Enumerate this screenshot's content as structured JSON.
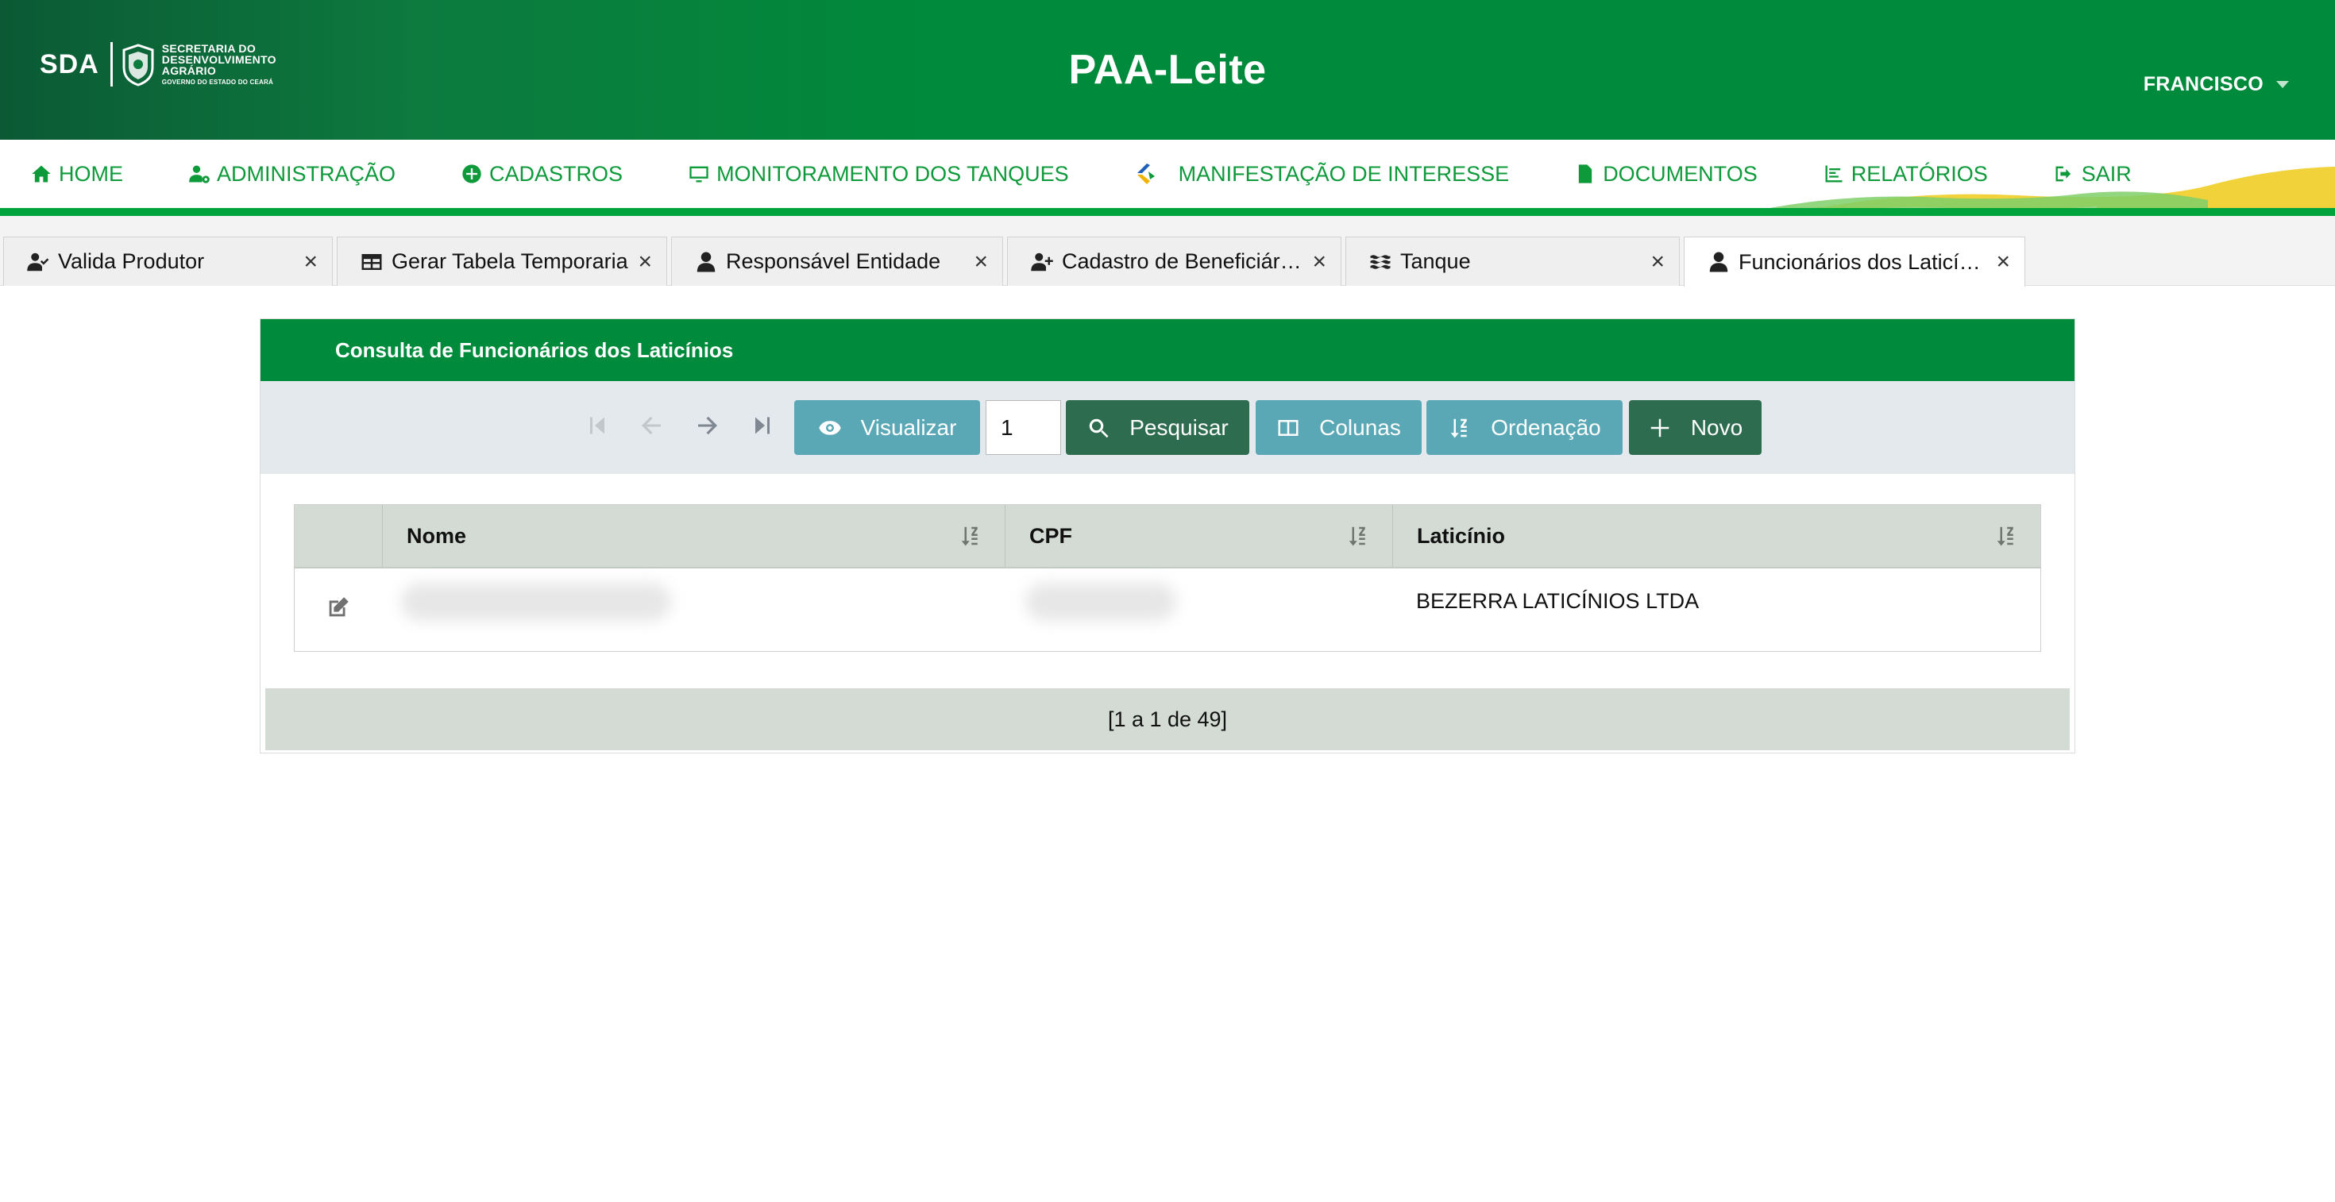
{
  "header": {
    "logo_abbr": "SDA",
    "logo_line1": "SECRETARIA DO",
    "logo_line2": "DESENVOLVIMENTO",
    "logo_line3": "AGRÁRIO",
    "logo_line4": "GOVERNO DO ESTADO DO CEARÁ",
    "title": "PAA-Leite",
    "user": "FRANCISCO"
  },
  "nav": {
    "items": [
      {
        "label": "HOME",
        "icon": "home-icon"
      },
      {
        "label": "ADMINISTRAÇÃO",
        "icon": "user-gear-icon"
      },
      {
        "label": "CADASTROS",
        "icon": "plus-circle-icon"
      },
      {
        "label": "MONITORAMENTO DOS TANQUES",
        "icon": "monitor-icon"
      },
      {
        "label": "MANIFESTAÇÃO DE INTERESSE",
        "icon": "manifestation-logo-icon"
      },
      {
        "label": "DOCUMENTOS",
        "icon": "document-icon"
      },
      {
        "label": "RELATÓRIOS",
        "icon": "chart-icon"
      },
      {
        "label": "SAIR",
        "icon": "sign-out-icon"
      }
    ]
  },
  "tabs": [
    {
      "label": "Valida Produtor",
      "icon": "user-check-icon"
    },
    {
      "label": "Gerar Tabela Temporaria",
      "icon": "table-icon"
    },
    {
      "label": "Responsável Entidade",
      "icon": "user-icon"
    },
    {
      "label": "Cadastro de Beneficiários",
      "icon": "user-plus-icon"
    },
    {
      "label": "Tanque",
      "icon": "water-icon"
    },
    {
      "label": "Funcionários dos Laticínios",
      "icon": "user-icon"
    }
  ],
  "panel": {
    "title": "Consulta de Funcionários dos Laticínios",
    "toolbar": {
      "visualizar": "Visualizar",
      "page": "1",
      "pesquisar": "Pesquisar",
      "colunas": "Colunas",
      "ordenacao": "Ordenação",
      "novo": "Novo"
    },
    "columns": [
      "Nome",
      "CPF",
      "Laticínio"
    ],
    "rows": [
      {
        "nome": "",
        "cpf": "",
        "laticinio": "BEZERRA LATICÍNIOS LTDA"
      }
    ],
    "pagination": "[1 a 1 de 49]"
  },
  "colors": {
    "header_green": "#008a3b",
    "nav_green": "#0e9a3b",
    "btn_info": "#5aa8b6",
    "btn_dark": "#2e6c4f",
    "grid_header": "#d3dbd4"
  }
}
